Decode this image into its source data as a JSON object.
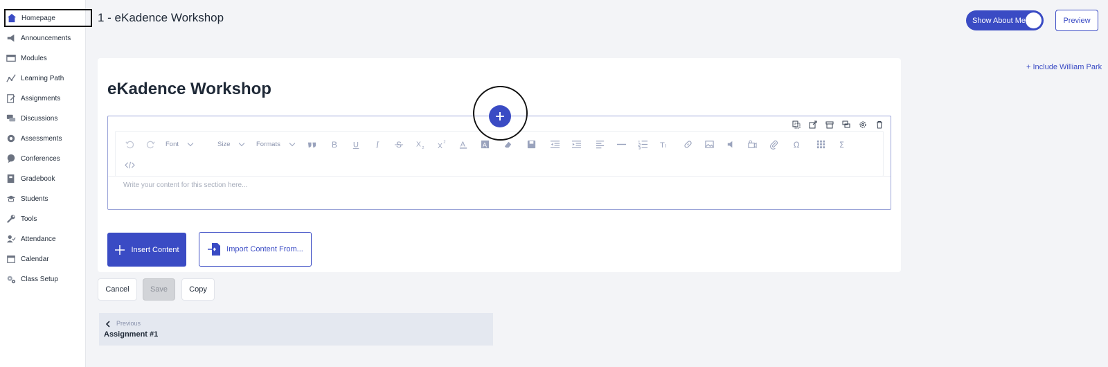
{
  "sidebar": {
    "items": [
      {
        "label": "Homepage",
        "icon": "home-icon",
        "active": true
      },
      {
        "label": "Announcements",
        "icon": "megaphone-icon"
      },
      {
        "label": "Modules",
        "icon": "modules-icon"
      },
      {
        "label": "Learning Path",
        "icon": "learning-path-icon"
      },
      {
        "label": "Assignments",
        "icon": "assignment-icon"
      },
      {
        "label": "Discussions",
        "icon": "discussion-icon"
      },
      {
        "label": "Assessments",
        "icon": "assessment-icon"
      },
      {
        "label": "Conferences",
        "icon": "conference-icon"
      },
      {
        "label": "Gradebook",
        "icon": "gradebook-icon"
      },
      {
        "label": "Students",
        "icon": "students-icon"
      },
      {
        "label": "Tools",
        "icon": "tools-icon"
      },
      {
        "label": "Attendance",
        "icon": "attendance-icon"
      },
      {
        "label": "Calendar",
        "icon": "calendar-icon"
      },
      {
        "label": "Class Setup",
        "icon": "gear-icon"
      }
    ]
  },
  "header": {
    "title": "1 - eKadence Workshop",
    "toggle_label": "Show About Me",
    "toggle_on": true,
    "preview_label": "Preview",
    "include_link": "+ Include William Park"
  },
  "section": {
    "title": "eKadence Workshop"
  },
  "editor": {
    "font_label": "Font",
    "size_label": "Size",
    "formats_label": "Formats",
    "placeholder": "Write your content for this section here..."
  },
  "content_buttons": {
    "insert_label": "Insert Content",
    "import_label": "Import Content From..."
  },
  "actions": {
    "cancel_label": "Cancel",
    "save_label": "Save",
    "copy_label": "Copy"
  },
  "previous": {
    "label": "Previous",
    "title": "Assignment #1"
  },
  "colors": {
    "accent": "#3a4bc4",
    "sidebar_bg": "#ffffff",
    "page_bg": "#f3f4f7"
  }
}
